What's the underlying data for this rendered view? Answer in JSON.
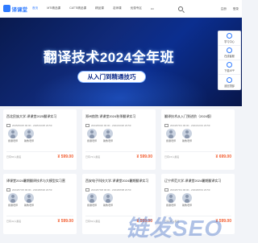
{
  "header": {
    "logo_text": "译课堂",
    "nav": [
      "首页",
      "MTI精品课",
      "CATTI精品课",
      "精品课",
      "名师课",
      "优惠专区",
      "•••"
    ],
    "auth": [
      "注册",
      "登录"
    ]
  },
  "banner": {
    "title": "翻译技术2024全年班",
    "subtitle": "从入门到精通技巧",
    "slides": 5,
    "active_slide": 3
  },
  "rail": [
    "学习中心",
    "在线客服",
    "下载APP",
    "返回顶部"
  ],
  "courses": [
    {
      "title": "西北民族大学-译课堂2025翻译实习",
      "date": "2025/09/25 00:00 - 2025/10/25 23:59",
      "teachers": [
        "授课老师",
        "助教老师"
      ],
      "enroll": "已有66人报名",
      "price": "¥ 599.00"
    },
    {
      "title": "郑州航院-译课堂2024秋季翻译实习",
      "date": "2024/09/20 00:00 - 2024/10/20 23:59",
      "teachers": [
        "授课老师",
        "助教老师"
      ],
      "enroll": "已有74人报名",
      "price": "¥ 599.00"
    },
    {
      "title": "翻译技术从入门到进阶（2024版）",
      "date": "2024/07/01 00:00 - 2024/12/31 23:59",
      "teachers": [
        "授课老师",
        "助教老师"
      ],
      "enroll": "已有15人报名",
      "price": "¥ 699.00"
    },
    {
      "title": "译课堂2024暑期翻译技术与大模型实习营",
      "date": "2024/07/15 00:00 - 2024/08/20 23:59",
      "teachers": [
        "授课老师",
        "助教老师"
      ],
      "enroll": "已有41人报名",
      "price": "¥ 599.00"
    },
    {
      "title": "西安电子科技大学-译课堂2024暑期翻译实习",
      "date": "2024/07/08 00:00 - 2024/08/08 23:59",
      "teachers": [
        "授课老师",
        "助教老师"
      ],
      "enroll": "已有53人报名",
      "price": "¥ 599.00"
    },
    {
      "title": "辽宁师范大学-译课堂2024暑期翻译实习",
      "date": "2024/07/01 00:00 - 2024/08/01 23:59",
      "teachers": [
        "授课老师",
        "助教老师"
      ],
      "enroll": "已有38人报名",
      "price": "¥ 599.00"
    }
  ],
  "watermark": "链发SEO"
}
